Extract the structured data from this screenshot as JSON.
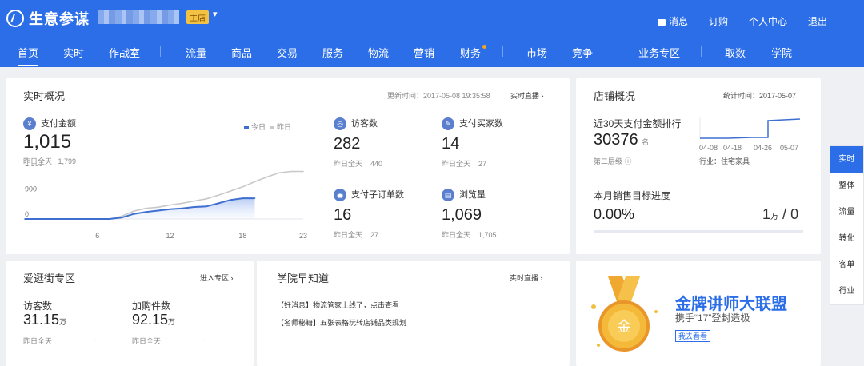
{
  "header": {
    "logo_text": "生意参谋",
    "shop_badge": "主店",
    "links": [
      {
        "label": "消息",
        "icon": "message-icon"
      },
      {
        "label": "订购"
      },
      {
        "label": "个人中心"
      },
      {
        "label": "退出"
      }
    ]
  },
  "nav": {
    "items": [
      "首页",
      "实时",
      "作战室",
      "流量",
      "商品",
      "交易",
      "服务",
      "物流",
      "营销",
      "财务",
      "市场",
      "竞争",
      "业务专区",
      "取数",
      "学院"
    ],
    "active": "首页"
  },
  "realtime": {
    "title": "实时概况",
    "update_time": "更新时间：2017-05-08 19:35:58",
    "live_link": "实时直播",
    "pay_amount_label": "支付金额",
    "pay_amount": "1,015",
    "yesterday_label": "昨日全天",
    "yesterday_pay": "1,799",
    "legend_today": "今日",
    "legend_yesterday": "昨日",
    "metrics": [
      {
        "label": "访客数",
        "value": "282",
        "yday": "440"
      },
      {
        "label": "支付买家数",
        "value": "14",
        "yday": "27"
      },
      {
        "label": "支付子订单数",
        "value": "16",
        "yday": "27"
      },
      {
        "label": "浏览量",
        "value": "1,069",
        "yday": "1,705"
      }
    ]
  },
  "chart_data": {
    "type": "area",
    "y_ticks": [
      "1,800",
      "900",
      "0"
    ],
    "x_ticks": [
      "6",
      "12",
      "18",
      "23"
    ],
    "ylim": [
      0,
      1800
    ],
    "xlim": [
      0,
      23
    ],
    "series": [
      {
        "name": "今日",
        "color": "#3f6fd0",
        "x": [
          0,
          1,
          2,
          3,
          4,
          5,
          6,
          7,
          8,
          9,
          10,
          11,
          12,
          13,
          14,
          15,
          16,
          17,
          18,
          19
        ],
        "values": [
          0,
          0,
          0,
          0,
          0,
          0,
          0,
          0,
          50,
          180,
          250,
          300,
          350,
          380,
          430,
          450,
          560,
          680,
          740,
          740
        ]
      },
      {
        "name": "昨日",
        "color": "#c8c8c8",
        "x": [
          0,
          1,
          2,
          3,
          4,
          5,
          6,
          7,
          8,
          9,
          10,
          11,
          12,
          13,
          14,
          15,
          16,
          17,
          18,
          19,
          20,
          21,
          22,
          23
        ],
        "values": [
          0,
          0,
          0,
          0,
          0,
          0,
          0,
          0,
          100,
          280,
          380,
          420,
          500,
          560,
          640,
          720,
          850,
          1000,
          1150,
          1330,
          1500,
          1650,
          1700,
          1700
        ]
      }
    ]
  },
  "store": {
    "title": "店铺概况",
    "stat_time": "统计时间：2017-05-07",
    "rank_label": "近30天支付金额排行",
    "rank_value": "30376",
    "rank_unit": "名",
    "level": "第二层级",
    "industry": "行业：住宅家具",
    "spark_ticks": [
      "04-08",
      "04-18",
      "04-26",
      "05-07"
    ],
    "target_label": "本月销售目标进度",
    "target_percent": "0.00%",
    "target_value": "1",
    "target_unit": "万",
    "target_sep": "/",
    "target_current": "0",
    "progress": 0
  },
  "aiguangjie": {
    "title": "爱逛街专区",
    "enter_link": "进入专区",
    "visitor_label": "访客数",
    "visitor_value": "31.15",
    "visitor_unit": "万",
    "cart_label": "加购件数",
    "cart_value": "92.15",
    "cart_unit": "万",
    "yday_label": "昨日全天",
    "yday_value": "-"
  },
  "academy": {
    "title": "学院早知道",
    "live_link": "实时直播",
    "items": [
      "【好消息】物流管家上线了，点击查看",
      "【名师秘籍】五张表格玩转店铺品类规划"
    ]
  },
  "promo": {
    "title": "金牌讲师大联盟",
    "subtitle": "携手“17”登封造极",
    "button": "我去看看",
    "medal_char": "金"
  },
  "right_tabs": [
    "实时",
    "整体",
    "流量",
    "转化",
    "客单",
    "行业"
  ]
}
